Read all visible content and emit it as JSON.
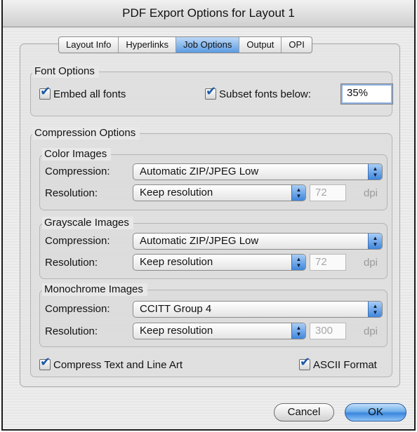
{
  "window": {
    "title": "PDF Export Options for Layout 1"
  },
  "tabs": [
    "Layout Info",
    "Hyperlinks",
    "Job Options",
    "Output",
    "OPI"
  ],
  "active_tab": "Job Options",
  "font_options": {
    "title": "Font Options",
    "embed_all_fonts": {
      "label": "Embed all fonts",
      "checked": true
    },
    "subset_fonts": {
      "label": "Subset fonts below:",
      "checked": true,
      "value": "35%"
    }
  },
  "compression_options": {
    "title": "Compression Options",
    "compression_label": "Compression:",
    "resolution_label": "Resolution:",
    "unit": "dpi",
    "color": {
      "title": "Color Images",
      "compression": "Automatic ZIP/JPEG Low",
      "resolution": "Keep resolution",
      "dpi": "72"
    },
    "grayscale": {
      "title": "Grayscale Images",
      "compression": "Automatic ZIP/JPEG Low",
      "resolution": "Keep resolution",
      "dpi": "72"
    },
    "monochrome": {
      "title": "Monochrome Images",
      "compression": "CCITT Group 4",
      "resolution": "Keep resolution",
      "dpi": "300"
    },
    "compress_text": {
      "label": "Compress Text and Line Art",
      "checked": true
    },
    "ascii_format": {
      "label": "ASCII Format",
      "checked": true
    }
  },
  "buttons": {
    "cancel": "Cancel",
    "ok": "OK"
  },
  "icons": {
    "checkmark": "check-icon",
    "popup_arrows": "updown-arrows-icon"
  },
  "colors": {
    "accent": "#4a90e2",
    "checkmark": "#1d5aa8"
  }
}
